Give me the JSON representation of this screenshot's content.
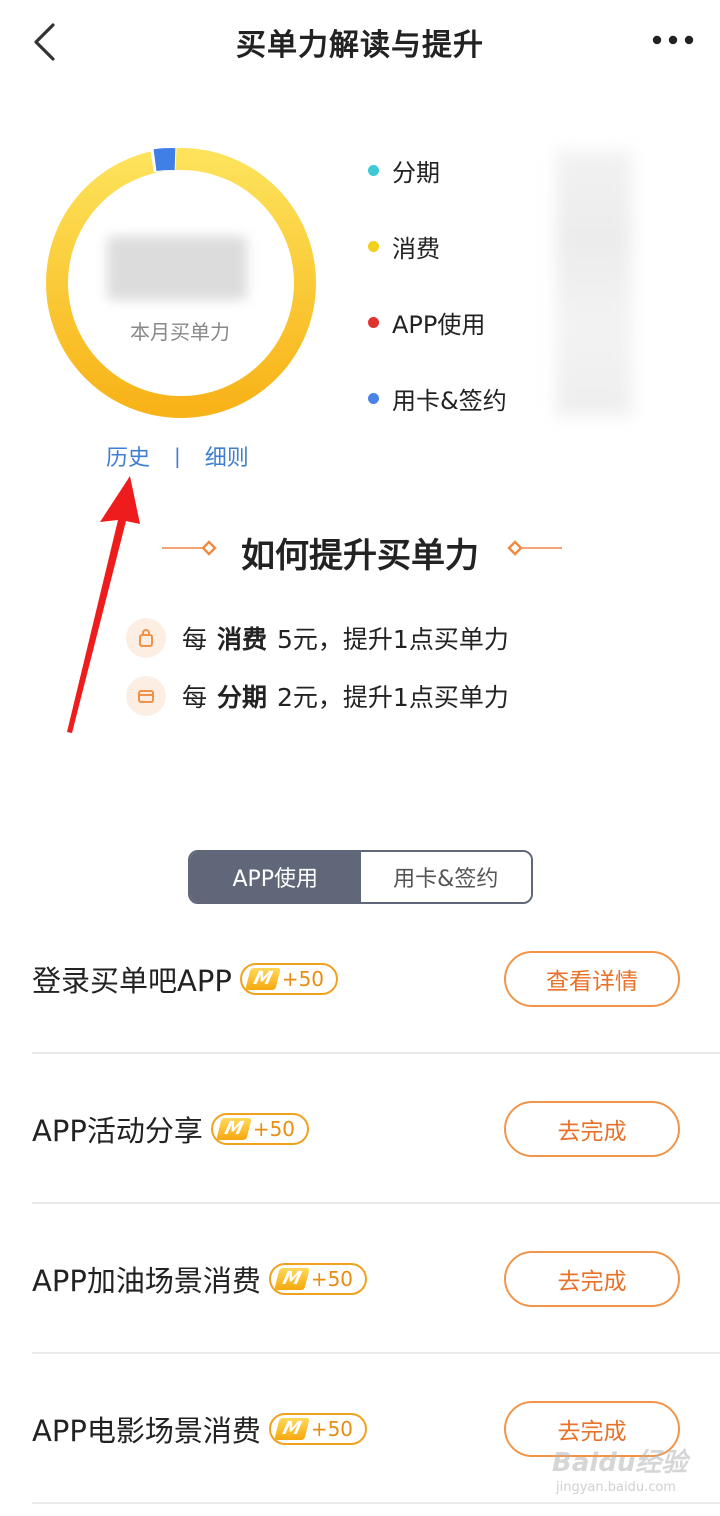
{
  "header": {
    "title": "买单力解读与提升",
    "back_icon": "chevron-left-icon",
    "more_icon": "more-dots-icon"
  },
  "summary": {
    "caption": "本月买单力",
    "value_hidden": true
  },
  "donut_colors": {
    "yellow_start": "#fde25a",
    "yellow_end": "#f8b318",
    "blue": "#3f7fe6"
  },
  "legend": [
    {
      "label": "分期",
      "color": "#3fc9d8"
    },
    {
      "label": "消费",
      "color": "#f3cf1d"
    },
    {
      "label": "APP使用",
      "color": "#e0332e"
    },
    {
      "label": "用卡&签约",
      "color": "#4a83e5"
    }
  ],
  "links": {
    "history": "历史",
    "separator": "|",
    "rules": "细则"
  },
  "improve": {
    "title": "如何提升买单力",
    "rules": [
      {
        "prefix": "每",
        "keyword": "消费",
        "suffix": "5元，提升1点买单力",
        "icon": "shopping-bag-icon"
      },
      {
        "prefix": "每",
        "keyword": "分期",
        "suffix": "2元，提升1点买单力",
        "icon": "card-icon"
      }
    ]
  },
  "tabs": [
    {
      "label": "APP使用",
      "active": true
    },
    {
      "label": "用卡&签约",
      "active": false
    }
  ],
  "tasks": [
    {
      "name": "登录买单吧APP",
      "badge_mark": "M",
      "points": "+50",
      "action": "查看详情"
    },
    {
      "name": "APP活动分享",
      "badge_mark": "M",
      "points": "+50",
      "action": "去完成"
    },
    {
      "name": "APP加油场景消费",
      "badge_mark": "M",
      "points": "+50",
      "action": "去完成"
    },
    {
      "name": "APP电影场景消费",
      "badge_mark": "M",
      "points": "+50",
      "action": "去完成"
    }
  ],
  "watermark": {
    "main": "Baidu经验",
    "sub": "jingyan.baidu.com"
  },
  "accent_color": "#e8722a"
}
